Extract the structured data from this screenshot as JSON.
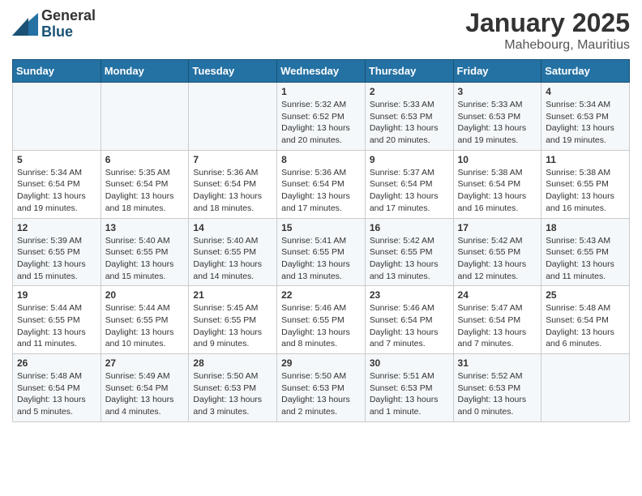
{
  "header": {
    "logo_general": "General",
    "logo_blue": "Blue",
    "title": "January 2025",
    "subtitle": "Mahebourg, Mauritius"
  },
  "weekdays": [
    "Sunday",
    "Monday",
    "Tuesday",
    "Wednesday",
    "Thursday",
    "Friday",
    "Saturday"
  ],
  "weeks": [
    [
      {
        "day": "",
        "info": ""
      },
      {
        "day": "",
        "info": ""
      },
      {
        "day": "",
        "info": ""
      },
      {
        "day": "1",
        "info": "Sunrise: 5:32 AM\nSunset: 6:52 PM\nDaylight: 13 hours\nand 20 minutes."
      },
      {
        "day": "2",
        "info": "Sunrise: 5:33 AM\nSunset: 6:53 PM\nDaylight: 13 hours\nand 20 minutes."
      },
      {
        "day": "3",
        "info": "Sunrise: 5:33 AM\nSunset: 6:53 PM\nDaylight: 13 hours\nand 19 minutes."
      },
      {
        "day": "4",
        "info": "Sunrise: 5:34 AM\nSunset: 6:53 PM\nDaylight: 13 hours\nand 19 minutes."
      }
    ],
    [
      {
        "day": "5",
        "info": "Sunrise: 5:34 AM\nSunset: 6:54 PM\nDaylight: 13 hours\nand 19 minutes."
      },
      {
        "day": "6",
        "info": "Sunrise: 5:35 AM\nSunset: 6:54 PM\nDaylight: 13 hours\nand 18 minutes."
      },
      {
        "day": "7",
        "info": "Sunrise: 5:36 AM\nSunset: 6:54 PM\nDaylight: 13 hours\nand 18 minutes."
      },
      {
        "day": "8",
        "info": "Sunrise: 5:36 AM\nSunset: 6:54 PM\nDaylight: 13 hours\nand 17 minutes."
      },
      {
        "day": "9",
        "info": "Sunrise: 5:37 AM\nSunset: 6:54 PM\nDaylight: 13 hours\nand 17 minutes."
      },
      {
        "day": "10",
        "info": "Sunrise: 5:38 AM\nSunset: 6:54 PM\nDaylight: 13 hours\nand 16 minutes."
      },
      {
        "day": "11",
        "info": "Sunrise: 5:38 AM\nSunset: 6:55 PM\nDaylight: 13 hours\nand 16 minutes."
      }
    ],
    [
      {
        "day": "12",
        "info": "Sunrise: 5:39 AM\nSunset: 6:55 PM\nDaylight: 13 hours\nand 15 minutes."
      },
      {
        "day": "13",
        "info": "Sunrise: 5:40 AM\nSunset: 6:55 PM\nDaylight: 13 hours\nand 15 minutes."
      },
      {
        "day": "14",
        "info": "Sunrise: 5:40 AM\nSunset: 6:55 PM\nDaylight: 13 hours\nand 14 minutes."
      },
      {
        "day": "15",
        "info": "Sunrise: 5:41 AM\nSunset: 6:55 PM\nDaylight: 13 hours\nand 13 minutes."
      },
      {
        "day": "16",
        "info": "Sunrise: 5:42 AM\nSunset: 6:55 PM\nDaylight: 13 hours\nand 13 minutes."
      },
      {
        "day": "17",
        "info": "Sunrise: 5:42 AM\nSunset: 6:55 PM\nDaylight: 13 hours\nand 12 minutes."
      },
      {
        "day": "18",
        "info": "Sunrise: 5:43 AM\nSunset: 6:55 PM\nDaylight: 13 hours\nand 11 minutes."
      }
    ],
    [
      {
        "day": "19",
        "info": "Sunrise: 5:44 AM\nSunset: 6:55 PM\nDaylight: 13 hours\nand 11 minutes."
      },
      {
        "day": "20",
        "info": "Sunrise: 5:44 AM\nSunset: 6:55 PM\nDaylight: 13 hours\nand 10 minutes."
      },
      {
        "day": "21",
        "info": "Sunrise: 5:45 AM\nSunset: 6:55 PM\nDaylight: 13 hours\nand 9 minutes."
      },
      {
        "day": "22",
        "info": "Sunrise: 5:46 AM\nSunset: 6:55 PM\nDaylight: 13 hours\nand 8 minutes."
      },
      {
        "day": "23",
        "info": "Sunrise: 5:46 AM\nSunset: 6:54 PM\nDaylight: 13 hours\nand 7 minutes."
      },
      {
        "day": "24",
        "info": "Sunrise: 5:47 AM\nSunset: 6:54 PM\nDaylight: 13 hours\nand 7 minutes."
      },
      {
        "day": "25",
        "info": "Sunrise: 5:48 AM\nSunset: 6:54 PM\nDaylight: 13 hours\nand 6 minutes."
      }
    ],
    [
      {
        "day": "26",
        "info": "Sunrise: 5:48 AM\nSunset: 6:54 PM\nDaylight: 13 hours\nand 5 minutes."
      },
      {
        "day": "27",
        "info": "Sunrise: 5:49 AM\nSunset: 6:54 PM\nDaylight: 13 hours\nand 4 minutes."
      },
      {
        "day": "28",
        "info": "Sunrise: 5:50 AM\nSunset: 6:53 PM\nDaylight: 13 hours\nand 3 minutes."
      },
      {
        "day": "29",
        "info": "Sunrise: 5:50 AM\nSunset: 6:53 PM\nDaylight: 13 hours\nand 2 minutes."
      },
      {
        "day": "30",
        "info": "Sunrise: 5:51 AM\nSunset: 6:53 PM\nDaylight: 13 hours\nand 1 minute."
      },
      {
        "day": "31",
        "info": "Sunrise: 5:52 AM\nSunset: 6:53 PM\nDaylight: 13 hours\nand 0 minutes."
      },
      {
        "day": "",
        "info": ""
      }
    ]
  ]
}
